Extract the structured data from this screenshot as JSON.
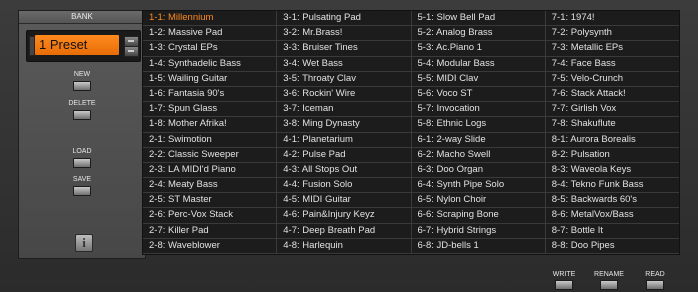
{
  "sidebar": {
    "bank_label": "BANK",
    "preset_display": "1 Preset",
    "buttons": {
      "new": "NEW",
      "delete": "DELETE",
      "load": "LOAD",
      "save": "SAVE"
    },
    "info_icon": "i"
  },
  "accent_color": "#ff8a1e",
  "presets": {
    "columns": [
      [
        "1-1: Millennium",
        "1-2: Massive Pad",
        "1-3: Crystal EPs",
        "1-4: Synthadelic Bass",
        "1-5: Wailing Guitar",
        "1-6: Fantasia 90's",
        "1-7: Spun Glass",
        "1-8: Mother Afrika!",
        "2-1: Swimotion",
        "2-2: Classic Sweeper",
        "2-3: LA MIDI'd Piano",
        "2-4: Meaty Bass",
        "2-5: ST Master",
        "2-6: Perc-Vox Stack",
        "2-7: Killer Pad",
        "2-8: Waveblower"
      ],
      [
        "3-1: Pulsating Pad",
        "3-2: Mr.Brass!",
        "3-3: Bruiser Tines",
        "3-4: Wet Bass",
        "3-5: Throaty Clav",
        "3-6: Rockin' Wire",
        "3-7: Iceman",
        "3-8: Ming Dynasty",
        "4-1: Planetarium",
        "4-2: Pulse Pad",
        "4-3: All Stops Out",
        "4-4: Fusion Solo",
        "4-5: MIDI Guitar",
        "4-6: Pain&Injury Keyz",
        "4-7: Deep Breath Pad",
        "4-8: Harlequin"
      ],
      [
        "5-1: Slow Bell Pad",
        "5-2: Analog Brass",
        "5-3: Ac.Piano 1",
        "5-4: Modular Bass",
        "5-5: MIDI Clav",
        "5-6: Voco ST",
        "5-7: Invocation",
        "5-8: Ethnic Logs",
        "6-1: 2-way Slide",
        "6-2: Macho Swell",
        "6-3: Doo Organ",
        "6-4: Synth Pipe Solo",
        "6-5: Nylon Choir",
        "6-6: Scraping Bone",
        "6-7: Hybrid Strings",
        "6-8: JD-bells 1"
      ],
      [
        "7-1: 1974!",
        "7-2: Polysynth",
        "7-3: Metallic EPs",
        "7-4: Face Bass",
        "7-5: Velo-Crunch",
        "7-6: Stack Attack!",
        "7-7: Girlish Vox",
        "7-8: Shakuflute",
        "8-1: Aurora Borealis",
        "8-2: Pulsation",
        "8-3: Waveola Keys",
        "8-4: Tekno Funk Bass",
        "8-5: Backwards 60's",
        "8-6: MetalVox/Bass",
        "8-7: Bottle It",
        "8-8: Doo Pipes"
      ]
    ],
    "selected": "1-1: Millennium"
  },
  "footer": {
    "write": "WRITE",
    "rename": "RENAME",
    "read": "READ"
  }
}
